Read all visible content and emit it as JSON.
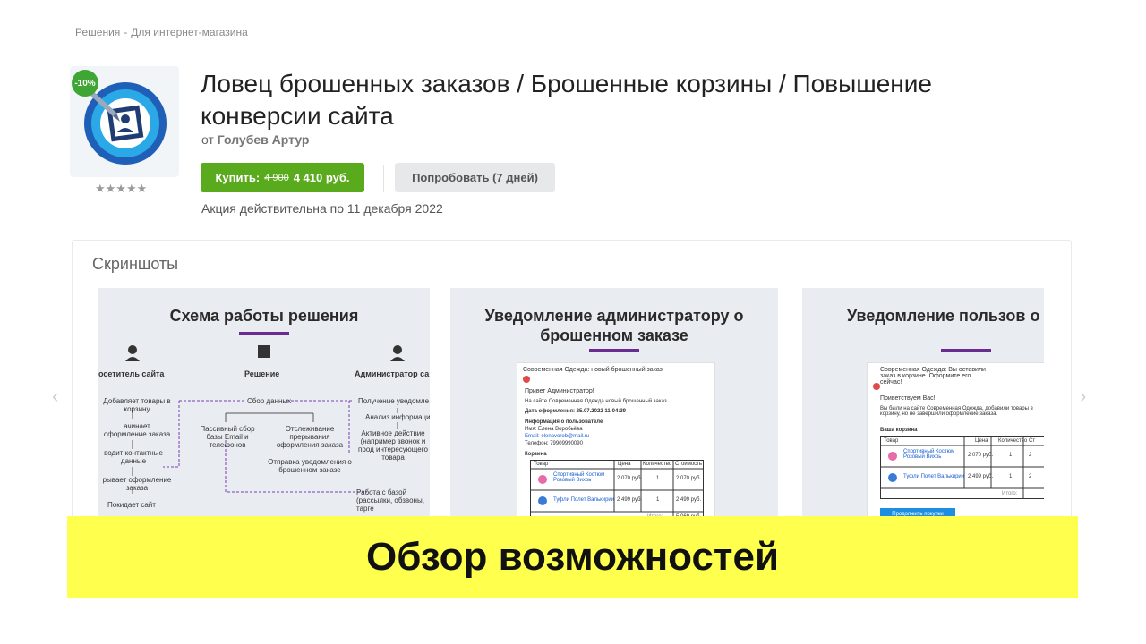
{
  "breadcrumb": [
    "Решения",
    "Для интернет-магазина"
  ],
  "app": {
    "discount_badge": "-10%",
    "rating_stars": "★★★★★",
    "title": "Ловец брошенных заказов / Брошенные корзины / Повышение конверсии сайта",
    "author_prefix": "от",
    "author_name": "Голубев Артур",
    "buy_label": "Купить:",
    "old_price": "4 900",
    "new_price": "4 410 руб.",
    "try_label": "Попробовать (7 дней)",
    "promo": "Акция действительна по 11 декабря 2022"
  },
  "screenshots": {
    "heading": "Скриншоты",
    "prev_icon": "‹",
    "next_icon": "›",
    "items": [
      {
        "title": "Схема работы решения",
        "roles": [
          "осетитель сайта",
          "Решение",
          "Администратор са"
        ],
        "left_steps": [
          "Добавляет товары в корзину",
          "ачинает оформление заказа",
          "водит контактные данные",
          "рывает оформление заказа",
          "Покидает сайт"
        ],
        "center_steps": [
          "Сбор данных",
          "Пассивный сбор базы Email и телефонов",
          "Отслеживание прерывания оформления заказа",
          "Отправка уведомления о брошенном заказе",
          "Работа с базой (рассылки, обзвоны, тарге"
        ],
        "right_steps": [
          "Получение уведомле",
          "Анализ информаци",
          "Активное действие (например звонок и прод интересующего товара"
        ]
      },
      {
        "title": "Уведомление администратору о брошенном заказе",
        "mail_subject": "Современная Одежда: новый брошенный заказ",
        "mail_greeting": "Привет Администратор!",
        "mail_body": "На сайте Современная Одежда новый брошенный заказ",
        "mail_date": "Дата оформления: 25.07.2022 11:04:39",
        "mail_user_header": "Информация о пользователе",
        "mail_name": "Имя: Елена Воробьёва",
        "mail_email": "Email: elenavorob@mail.ru",
        "mail_phone": "Телефон: 79909990090",
        "cart_header": "Корзина",
        "cols": [
          "Товар",
          "Цена",
          "Количество",
          "Стоимость"
        ],
        "rows": [
          [
            "Спортивный Костюм Розовый Вихрь",
            "2 070 руб.",
            "1",
            "2 070 руб."
          ],
          [
            "Туфли Полет Валькирии",
            "2 499 руб.",
            "1",
            "2 499 руб."
          ]
        ],
        "total_label": "Итого:",
        "total_value": "5 069 руб."
      },
      {
        "title": "Уведомление пользов о брошенной корзи",
        "mail_subject": "Современная Одежда: Вы оставили заказ в корзине. Оформите его сейчас!",
        "mail_greeting": "Приветствуем Вас!",
        "mail_body": "Вы были на сайте Современная Одежда, добавили товары в корзину, но не завершили оформление заказа.",
        "cart_header": "Ваша корзина",
        "cols": [
          "Товар",
          "Цена",
          "Количество",
          "Ст"
        ],
        "rows": [
          [
            "Спортивный Костюм Розовый Вихрь",
            "2 070 руб.",
            "1",
            "2"
          ],
          [
            "Туфли Полет Валькирии",
            "2 499 руб.",
            "1",
            "2"
          ]
        ],
        "total_label": "Итого:",
        "cta": "Продолжить покупки"
      }
    ]
  },
  "banner": "Обзор возможностей"
}
